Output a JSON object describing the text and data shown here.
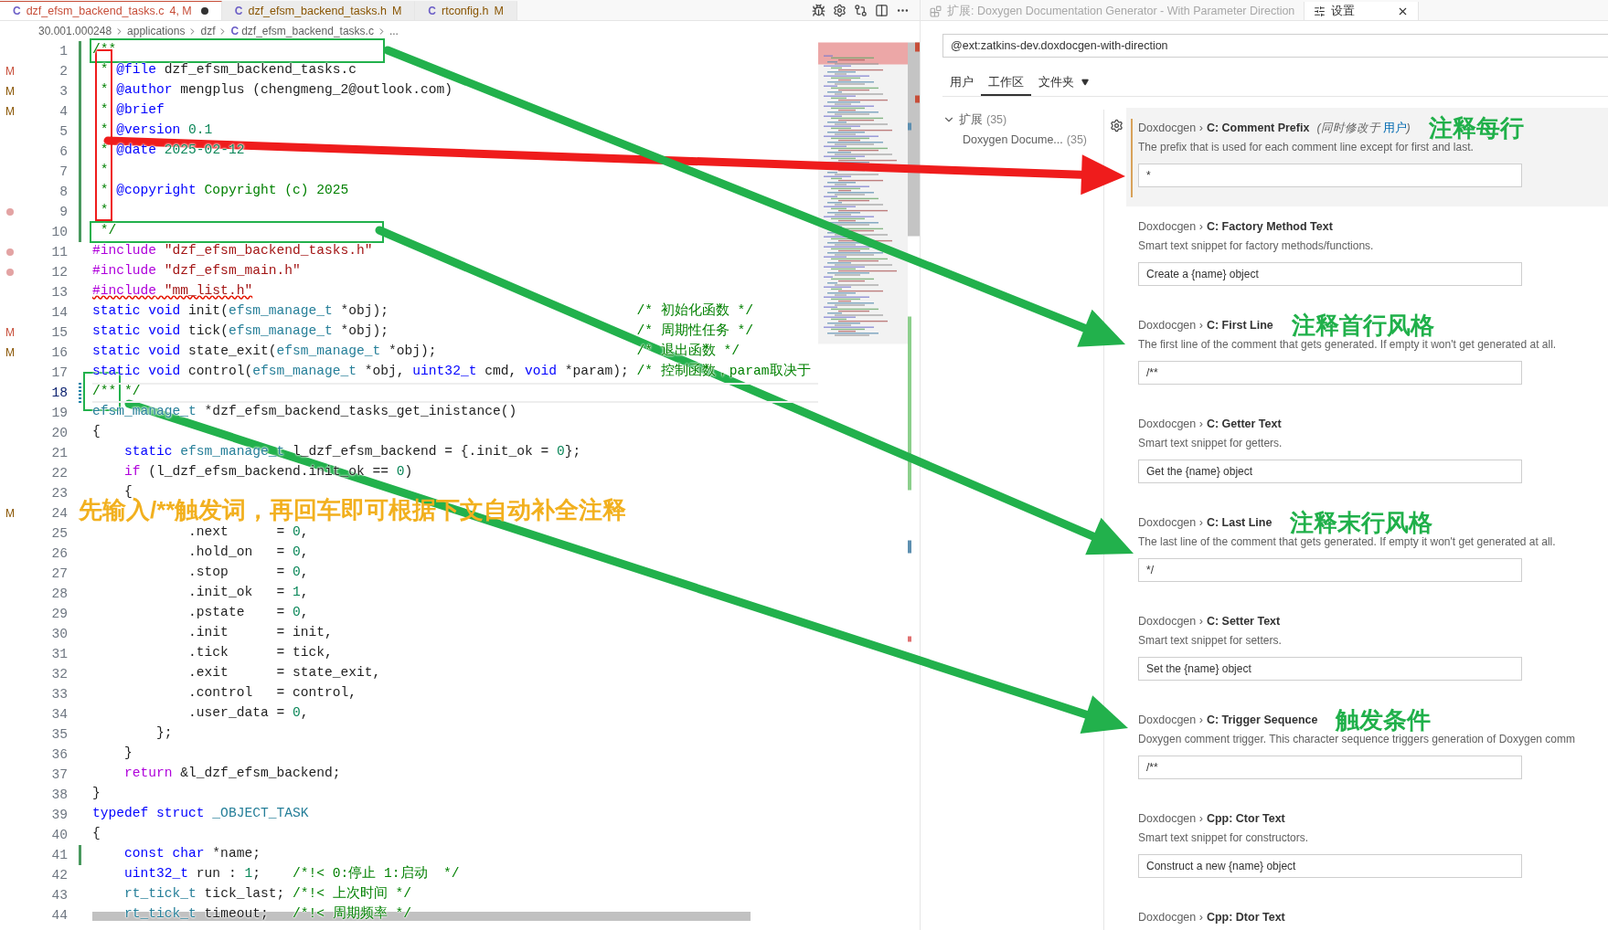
{
  "editor": {
    "tabs": [
      {
        "lang": "C",
        "name": "dzf_efsm_backend_tasks.c",
        "status": "4, M",
        "kind": "error",
        "dirty": true,
        "selected": true
      },
      {
        "lang": "C",
        "name": "dzf_efsm_backend_tasks.h",
        "status": "M",
        "kind": "modified",
        "dirty": false,
        "selected": false
      },
      {
        "lang": "C",
        "name": "rtconfig.h",
        "status": "M",
        "kind": "modified",
        "dirty": false,
        "selected": false
      }
    ],
    "breadcrumb": {
      "items": [
        "30.001.000248",
        "applications",
        "dzf"
      ],
      "file_lang": "C",
      "file": "dzf_efsm_backend_tasks.c",
      "more": "..."
    },
    "lines": [
      {
        "number": "1",
        "added": true,
        "modified": false,
        "current": false,
        "error": false,
        "segments": [
          {
            "kind": "com",
            "text": "/**"
          }
        ]
      },
      {
        "number": "2",
        "added": true,
        "modified": false,
        "current": false,
        "error": false,
        "gutter": {
          "kind": "text",
          "text": "M",
          "color": "#c74e39"
        },
        "segments": [
          {
            "kind": "com",
            "text": " * "
          },
          {
            "kind": "tag",
            "text": "@file"
          },
          {
            "kind": "plain",
            "text": " dzf_efsm_backend_tasks.c"
          }
        ]
      },
      {
        "number": "3",
        "added": true,
        "modified": false,
        "current": false,
        "error": false,
        "gutter": {
          "kind": "text",
          "text": "M",
          "color": "#895503"
        },
        "segments": [
          {
            "kind": "com",
            "text": " * "
          },
          {
            "kind": "tag",
            "text": "@author"
          },
          {
            "kind": "plain",
            "text": " mengplus (chengmeng_2@outlook.com)"
          }
        ]
      },
      {
        "number": "4",
        "added": true,
        "modified": false,
        "current": false,
        "error": false,
        "gutter": {
          "kind": "text",
          "text": "M",
          "color": "#895503"
        },
        "segments": [
          {
            "kind": "com",
            "text": " * "
          },
          {
            "kind": "tag",
            "text": "@brief"
          }
        ]
      },
      {
        "number": "5",
        "added": true,
        "modified": false,
        "current": false,
        "error": false,
        "segments": [
          {
            "kind": "com",
            "text": " * "
          },
          {
            "kind": "tag",
            "text": "@version"
          },
          {
            "kind": "num",
            "text": " 0.1"
          }
        ]
      },
      {
        "number": "6",
        "added": true,
        "modified": false,
        "current": false,
        "error": false,
        "segments": [
          {
            "kind": "com",
            "text": " * "
          },
          {
            "kind": "tag",
            "text": "@date"
          },
          {
            "kind": "num",
            "text": " 2025-02-12"
          }
        ]
      },
      {
        "number": "7",
        "added": true,
        "modified": false,
        "current": false,
        "error": false,
        "segments": [
          {
            "kind": "com",
            "text": " *"
          }
        ]
      },
      {
        "number": "8",
        "added": true,
        "modified": false,
        "current": false,
        "error": false,
        "segments": [
          {
            "kind": "com",
            "text": " * "
          },
          {
            "kind": "tag",
            "text": "@copyright"
          },
          {
            "kind": "com",
            "text": " Copyright (c) 2025"
          }
        ]
      },
      {
        "number": "9",
        "added": true,
        "modified": false,
        "current": false,
        "error": false,
        "gutter": {
          "kind": "dot",
          "color": "#e3a3a3"
        },
        "segments": [
          {
            "kind": "com",
            "text": " *"
          }
        ]
      },
      {
        "number": "10",
        "added": true,
        "modified": false,
        "current": false,
        "error": false,
        "segments": [
          {
            "kind": "com",
            "text": " */"
          }
        ]
      },
      {
        "number": "11",
        "added": false,
        "modified": false,
        "current": false,
        "error": false,
        "gutter": {
          "kind": "dot",
          "color": "#e3a3a3"
        },
        "segments": [
          {
            "kind": "pre",
            "text": "#include"
          },
          {
            "kind": "str",
            "text": " \"dzf_efsm_backend_tasks.h\""
          }
        ]
      },
      {
        "number": "12",
        "added": false,
        "modified": false,
        "current": false,
        "error": false,
        "gutter": {
          "kind": "dot",
          "color": "#e3a3a3"
        },
        "segments": [
          {
            "kind": "pre",
            "text": "#include"
          },
          {
            "kind": "str",
            "text": " \"dzf_efsm_main.h\""
          }
        ]
      },
      {
        "number": "13",
        "added": false,
        "modified": false,
        "current": false,
        "error": true,
        "segments": [
          {
            "kind": "pre",
            "text": "#include"
          },
          {
            "kind": "str",
            "text": " \"mm_list.h\""
          }
        ]
      },
      {
        "number": "14",
        "added": false,
        "modified": false,
        "current": false,
        "error": false,
        "segments": [
          {
            "kind": "kw",
            "text": "static void"
          },
          {
            "kind": "plain",
            "text": " init("
          },
          {
            "kind": "type",
            "text": "efsm_manage_t"
          },
          {
            "kind": "plain",
            "text": " *obj);                               "
          },
          {
            "kind": "com",
            "text": "/* 初始化函数 */"
          }
        ]
      },
      {
        "number": "15",
        "added": false,
        "modified": false,
        "current": false,
        "error": false,
        "gutter": {
          "kind": "text",
          "text": "M",
          "color": "#c74e39"
        },
        "segments": [
          {
            "kind": "kw",
            "text": "static void"
          },
          {
            "kind": "plain",
            "text": " tick("
          },
          {
            "kind": "type",
            "text": "efsm_manage_t"
          },
          {
            "kind": "plain",
            "text": " *obj);                               "
          },
          {
            "kind": "com",
            "text": "/* 周期性任务 */"
          }
        ]
      },
      {
        "number": "16",
        "added": false,
        "modified": false,
        "current": false,
        "error": false,
        "gutter": {
          "kind": "text",
          "text": "M",
          "color": "#895503"
        },
        "segments": [
          {
            "kind": "kw",
            "text": "static void"
          },
          {
            "kind": "plain",
            "text": " state_exit("
          },
          {
            "kind": "type",
            "text": "efsm_manage_t"
          },
          {
            "kind": "plain",
            "text": " *obj);                         "
          },
          {
            "kind": "com",
            "text": "/* 退出函数 */"
          }
        ]
      },
      {
        "number": "17",
        "added": false,
        "modified": false,
        "current": false,
        "error": false,
        "segments": [
          {
            "kind": "kw",
            "text": "static void"
          },
          {
            "kind": "plain",
            "text": " control("
          },
          {
            "kind": "type",
            "text": "efsm_manage_t"
          },
          {
            "kind": "plain",
            "text": " *obj, "
          },
          {
            "kind": "kw",
            "text": "uint32_t"
          },
          {
            "kind": "plain",
            "text": " cmd, "
          },
          {
            "kind": "kw",
            "text": "void"
          },
          {
            "kind": "plain",
            "text": " *param); "
          },
          {
            "kind": "com",
            "text": "/* 控制函数，param取决于"
          }
        ]
      },
      {
        "number": "18",
        "added": false,
        "modified": true,
        "current": true,
        "error": false,
        "segments": [
          {
            "kind": "com",
            "text": "/** */"
          }
        ]
      },
      {
        "number": "19",
        "added": false,
        "modified": false,
        "current": false,
        "error": false,
        "segments": [
          {
            "kind": "type",
            "text": "efsm_manage_t"
          },
          {
            "kind": "plain",
            "text": " *dzf_efsm_backend_tasks_get_inistance()"
          }
        ]
      },
      {
        "number": "20",
        "added": false,
        "modified": false,
        "current": false,
        "error": false,
        "segments": [
          {
            "kind": "plain",
            "text": "{"
          }
        ]
      },
      {
        "number": "21",
        "added": false,
        "modified": false,
        "current": false,
        "error": false,
        "segments": [
          {
            "kind": "kw",
            "text": "    static"
          },
          {
            "kind": "type",
            "text": " efsm_manage_t"
          },
          {
            "kind": "plain",
            "text": " l_dzf_efsm_backend = {.init_ok = "
          },
          {
            "kind": "num",
            "text": "0"
          },
          {
            "kind": "plain",
            "text": "};"
          }
        ]
      },
      {
        "number": "22",
        "added": false,
        "modified": false,
        "current": false,
        "error": false,
        "segments": [
          {
            "kind": "ctrl",
            "text": "    if"
          },
          {
            "kind": "plain",
            "text": " (l_dzf_efsm_backend.init_ok == "
          },
          {
            "kind": "num",
            "text": "0"
          },
          {
            "kind": "plain",
            "text": ")"
          }
        ]
      },
      {
        "number": "23",
        "added": false,
        "modified": false,
        "current": false,
        "error": false,
        "segments": [
          {
            "kind": "plain",
            "text": "    {"
          }
        ]
      },
      {
        "number": "24",
        "added": false,
        "modified": false,
        "current": false,
        "gutter": {
          "kind": "text",
          "text": "M",
          "color": "#895503"
        }
      },
      {
        "number": "25",
        "added": false,
        "modified": false,
        "current": false,
        "error": false,
        "segments": [
          {
            "kind": "plain",
            "text": "            .next      = "
          },
          {
            "kind": "num",
            "text": "0"
          },
          {
            "kind": "plain",
            "text": ","
          }
        ]
      },
      {
        "number": "26",
        "added": false,
        "modified": false,
        "current": false,
        "error": false,
        "segments": [
          {
            "kind": "plain",
            "text": "            .hold_on   = "
          },
          {
            "kind": "num",
            "text": "0"
          },
          {
            "kind": "plain",
            "text": ","
          }
        ]
      },
      {
        "number": "27",
        "added": false,
        "modified": false,
        "current": false,
        "error": false,
        "segments": [
          {
            "kind": "plain",
            "text": "            .stop      = "
          },
          {
            "kind": "num",
            "text": "0"
          },
          {
            "kind": "plain",
            "text": ","
          }
        ]
      },
      {
        "number": "28",
        "added": false,
        "modified": false,
        "current": false,
        "error": false,
        "segments": [
          {
            "kind": "plain",
            "text": "            .init_ok   = "
          },
          {
            "kind": "num",
            "text": "1"
          },
          {
            "kind": "plain",
            "text": ","
          }
        ]
      },
      {
        "number": "29",
        "added": false,
        "modified": false,
        "current": false,
        "error": false,
        "segments": [
          {
            "kind": "plain",
            "text": "            .pstate    = "
          },
          {
            "kind": "num",
            "text": "0"
          },
          {
            "kind": "plain",
            "text": ","
          }
        ]
      },
      {
        "number": "30",
        "added": false,
        "modified": false,
        "current": false,
        "error": false,
        "segments": [
          {
            "kind": "plain",
            "text": "            .init      = init,"
          }
        ]
      },
      {
        "number": "31",
        "added": false,
        "modified": false,
        "current": false,
        "error": false,
        "segments": [
          {
            "kind": "plain",
            "text": "            .tick      = tick,"
          }
        ]
      },
      {
        "number": "32",
        "added": false,
        "modified": false,
        "current": false,
        "error": false,
        "segments": [
          {
            "kind": "plain",
            "text": "            .exit      = state_exit,"
          }
        ]
      },
      {
        "number": "33",
        "added": false,
        "modified": false,
        "current": false,
        "error": false,
        "segments": [
          {
            "kind": "plain",
            "text": "            .control   = control,"
          }
        ]
      },
      {
        "number": "34",
        "added": false,
        "modified": false,
        "current": false,
        "error": false,
        "segments": [
          {
            "kind": "plain",
            "text": "            .user_data = "
          },
          {
            "kind": "num",
            "text": "0"
          },
          {
            "kind": "plain",
            "text": ","
          }
        ]
      },
      {
        "number": "35",
        "added": false,
        "modified": false,
        "current": false,
        "error": false,
        "segments": [
          {
            "kind": "plain",
            "text": "        };"
          }
        ]
      },
      {
        "number": "36",
        "added": false,
        "modified": false,
        "current": false,
        "error": false,
        "segments": [
          {
            "kind": "plain",
            "text": "    }"
          }
        ]
      },
      {
        "number": "37",
        "added": false,
        "modified": false,
        "current": false,
        "error": false,
        "segments": [
          {
            "kind": "ctrl",
            "text": "    return"
          },
          {
            "kind": "plain",
            "text": " &l_dzf_efsm_backend;"
          }
        ]
      },
      {
        "number": "38",
        "added": false,
        "modified": false,
        "current": false,
        "error": false,
        "segments": [
          {
            "kind": "plain",
            "text": "}"
          }
        ]
      },
      {
        "number": "39",
        "added": false,
        "modified": false,
        "current": false,
        "error": false,
        "segments": [
          {
            "kind": "kw",
            "text": "typedef struct"
          },
          {
            "kind": "type",
            "text": " _OBJECT_TASK"
          }
        ]
      },
      {
        "number": "40",
        "added": false,
        "modified": false,
        "current": false,
        "error": false,
        "segments": [
          {
            "kind": "plain",
            "text": "{"
          }
        ]
      },
      {
        "number": "41",
        "added": true,
        "modified": false,
        "current": false,
        "error": false,
        "segments": [
          {
            "kind": "kw",
            "text": "    const char"
          },
          {
            "kind": "plain",
            "text": " *name;"
          }
        ]
      },
      {
        "number": "42",
        "added": false,
        "modified": false,
        "current": false,
        "error": false,
        "segments": [
          {
            "kind": "kw",
            "text": "    uint32_t"
          },
          {
            "kind": "plain",
            "text": " run : "
          },
          {
            "kind": "num",
            "text": "1"
          },
          {
            "kind": "plain",
            "text": ";    "
          },
          {
            "kind": "com",
            "text": "/*!< 0:停止 1:启动  */"
          }
        ]
      },
      {
        "number": "43",
        "added": false,
        "modified": false,
        "current": false,
        "error": false,
        "segments": [
          {
            "kind": "type",
            "text": "    rt_tick_t"
          },
          {
            "kind": "plain",
            "text": " tick_last; "
          },
          {
            "kind": "com",
            "text": "/*!< 上次时间 */"
          }
        ]
      },
      {
        "number": "44",
        "added": false,
        "modified": false,
        "current": false,
        "error": false,
        "segments": [
          {
            "kind": "type",
            "text": "    rt_tick_t"
          },
          {
            "kind": "plain",
            "text": " timeout;   "
          },
          {
            "kind": "com",
            "text": "/*!< 周期频率 */"
          }
        ]
      }
    ]
  },
  "settings": {
    "tabs": [
      {
        "kind": "extension",
        "label": "扩展: Doxygen Documentation Generator - With Parameter Direction",
        "selected": false
      },
      {
        "kind": "settings",
        "label": "设置",
        "selected": true
      }
    ],
    "search": {
      "value": "@ext:zatkins-dev.doxdocgen-with-direction"
    },
    "scopes": [
      {
        "label": "用户",
        "selected": false,
        "dropdown": false
      },
      {
        "label": "工作区",
        "selected": true,
        "dropdown": false
      },
      {
        "label": "文件夹",
        "selected": false,
        "dropdown": true
      }
    ],
    "tree": [
      {
        "label": "扩展",
        "count": "(35)",
        "expanded": true,
        "children": [
          {
            "label": "Doxygen Docume...",
            "count": "(35)"
          }
        ]
      }
    ],
    "items": [
      {
        "prefix": "Doxdocgen ›",
        "name": "C: Comment Prefix",
        "also_modified": {
          "text": "(同时修改于",
          "link": "用户",
          "end": ")"
        },
        "note": "注释每行",
        "description": "The prefix that is used for each comment line except for first and last.",
        "value": "*",
        "focused": true,
        "modified": true
      },
      {
        "prefix": "Doxdocgen ›",
        "name": "C: Factory Method Text",
        "description": "Smart text snippet for factory methods/functions.",
        "value": "Create a {name} object",
        "focused": false,
        "modified": false
      },
      {
        "prefix": "Doxdocgen ›",
        "name": "C: First Line",
        "note": "注释首行风格",
        "description": "The first line of the comment that gets generated. If empty it won't get generated at all.",
        "value": "/**",
        "focused": false,
        "modified": false
      },
      {
        "prefix": "Doxdocgen ›",
        "name": "C: Getter Text",
        "description": "Smart text snippet for getters.",
        "value": "Get the {name} object",
        "focused": false,
        "modified": false
      },
      {
        "prefix": "Doxdocgen ›",
        "name": "C: Last Line",
        "note": "注释末行风格",
        "description": "The last line of the comment that gets generated. If empty it won't get generated at all.",
        "value": "*/",
        "focused": false,
        "modified": false
      },
      {
        "prefix": "Doxdocgen ›",
        "name": "C: Setter Text",
        "description": "Smart text snippet for setters.",
        "value": "Set the {name} object",
        "focused": false,
        "modified": false
      },
      {
        "prefix": "Doxdocgen ›",
        "name": "C: Trigger Sequence",
        "note": "触发条件",
        "description": "Doxygen comment trigger. This character sequence triggers generation of Doxygen comm",
        "value": "/**",
        "focused": false,
        "modified": false
      },
      {
        "prefix": "Doxdocgen ›",
        "name": "Cpp: Ctor Text",
        "description": "Smart text snippet for constructors.",
        "value": "Construct a new {name} object",
        "focused": false,
        "modified": false
      },
      {
        "prefix": "Doxdocgen ›",
        "name": "Cpp: Dtor Text",
        "focused": false,
        "modified": false
      }
    ]
  },
  "annotation": {
    "caption": "先输入/**触发词，再回车即可根据下文自动补全注释",
    "frames": [
      {
        "color": "#22b14c"
      },
      {
        "color": "#ef1c1c"
      },
      {
        "color": "#22b14c"
      },
      {
        "color": "#22b14c"
      }
    ],
    "arrows": [
      {
        "color": "#ef1c1c"
      },
      {
        "color": "#22b14c"
      },
      {
        "color": "#22b14c"
      },
      {
        "color": "#22b14c"
      }
    ]
  }
}
